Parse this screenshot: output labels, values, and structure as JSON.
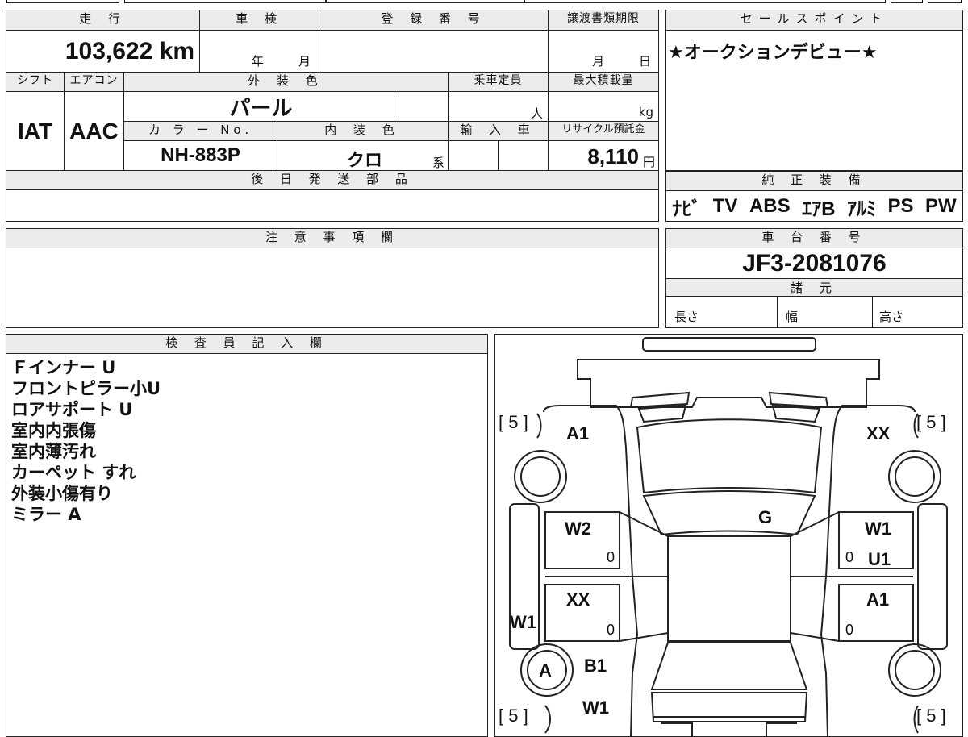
{
  "vehicle": {
    "mileage_label": "走 行",
    "mileage_value": "103,622 km",
    "inspection_label": "車 検",
    "inspection_year": "年",
    "inspection_month": "月",
    "registration_label": "登 録 番 号",
    "transfer_label": "譲渡書類期限",
    "transfer_month": "月",
    "transfer_day": "日",
    "shift_label": "シフト",
    "shift_value": "IAT",
    "aircon_label": "エアコン",
    "aircon_value": "AAC",
    "exterior_label": "外 装 色",
    "exterior_value": "パール",
    "capacity_label": "乗車定員",
    "capacity_unit": "人",
    "max_load_label": "最大積載量",
    "max_load_unit": "kg",
    "color_no_label": "カ ラ ー No.",
    "color_no_value": "NH-883P",
    "interior_label": "内 装 色",
    "interior_value": "クロ",
    "interior_suffix": "系",
    "import_label": "輸 入 車",
    "recycle_label": "リサイクル預託金",
    "recycle_value": "8,110",
    "recycle_unit": "円",
    "later_parts_label": "後 日 発 送 部 品"
  },
  "sales": {
    "label": "セールスポイント",
    "text": "★オークションデビュー★"
  },
  "equipment": {
    "label": "純 正 装 備",
    "items": [
      "ﾅﾋﾞ",
      "TV",
      "ABS",
      "ｴｱB",
      "ｱﾙﾐ",
      "PS",
      "PW"
    ]
  },
  "notes": {
    "label": "注 意 事 項 欄"
  },
  "chassis": {
    "label": "車 台 番 号",
    "value": "JF3-2081076",
    "spec_label": "諸 元",
    "length_label": "長さ",
    "width_label": "幅",
    "height_label": "高さ"
  },
  "inspector": {
    "label": "検 査 員 記 入 欄",
    "lines": [
      "Ｆインナー U",
      "フロントピラー小U",
      "ロアサポート U",
      "室内内張傷",
      "室内薄汚れ",
      "カーペット すれ",
      "外装小傷有り",
      "ミラー A"
    ]
  },
  "diagram": {
    "tire_left_top": "[ 5 ]",
    "tire_right_top": "[ 5 ]",
    "tire_left_bottom": "[ 5 ]",
    "tire_right_bottom": "[ 5 ]",
    "marks": {
      "a1_front_left": "A1",
      "xx_front_right": "XX",
      "g_windshield": "G",
      "w2_left_front_door": "W2",
      "w1_right_front_door": "W1",
      "u1_right_front_door": "U1",
      "zero_lf": "0",
      "zero_rf": "0",
      "xx_left_rear_door": "XX",
      "a1_right_rear_door": "A1",
      "zero_lr": "0",
      "zero_rr": "0",
      "w1_left_side": "W1",
      "a_left_rear_wheel": "A",
      "b1_left_rear": "B1",
      "w1_left_bottom": "W1"
    }
  }
}
